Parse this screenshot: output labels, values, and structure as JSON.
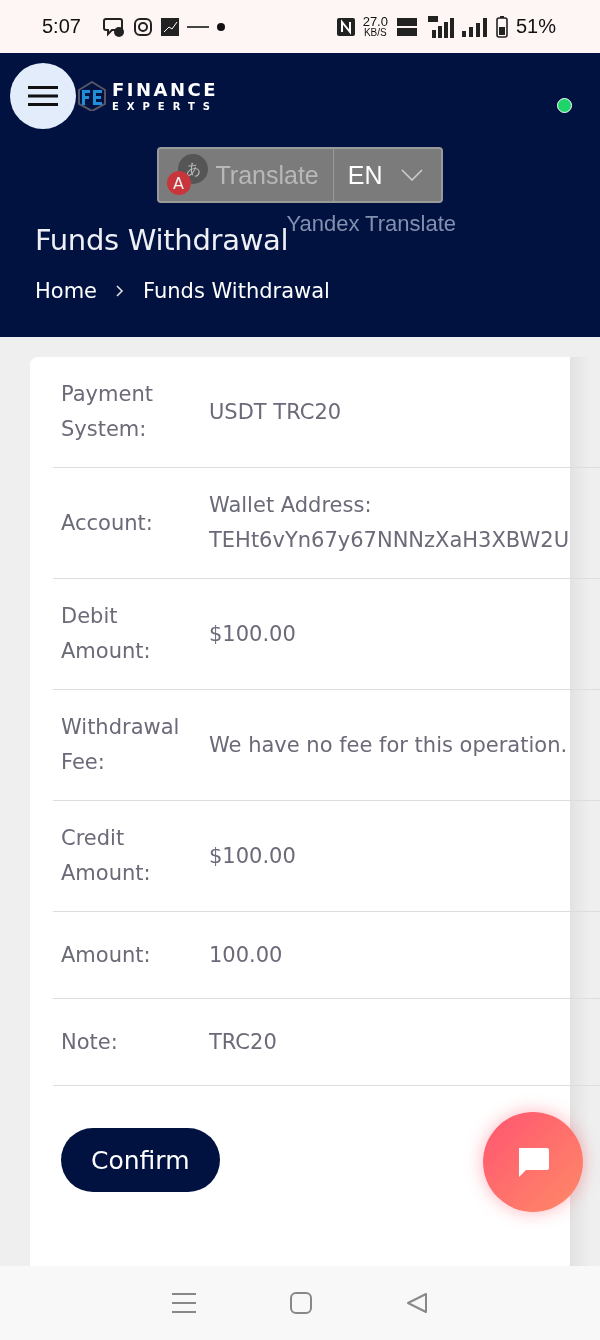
{
  "status_bar": {
    "time": "5:07",
    "speed": "27.0",
    "speed_unit": "KB/S",
    "battery": "51%"
  },
  "header": {
    "logo_top": "FINANCE",
    "logo_bottom": "EXPERTS",
    "online": true,
    "translate": {
      "icon_text": [
        "あ",
        "A"
      ],
      "label": "Translate",
      "language": "EN",
      "credit": "Yandex Translate"
    },
    "title": "Funds Withdrawal",
    "breadcrumbs": [
      "Home",
      "Funds Withdrawal"
    ]
  },
  "details": [
    {
      "label": "Payment System:",
      "lines": [
        "USDT TRC20"
      ]
    },
    {
      "label": "Account:",
      "lines": [
        "Wallet Address:",
        "TEHt6vYn67y67NNNzXaH3XBW2U"
      ]
    },
    {
      "label": "Debit Amount:",
      "lines": [
        "$100.00"
      ]
    },
    {
      "label": "Withdrawal Fee:",
      "lines": [
        "We have no fee for this operation."
      ]
    },
    {
      "label": "Credit Amount:",
      "lines": [
        "$100.00"
      ]
    },
    {
      "label": "Amount:",
      "lines": [
        "100.00"
      ]
    },
    {
      "label": "Note:",
      "lines": [
        "TRC20"
      ]
    }
  ],
  "confirm_button": "Confirm"
}
